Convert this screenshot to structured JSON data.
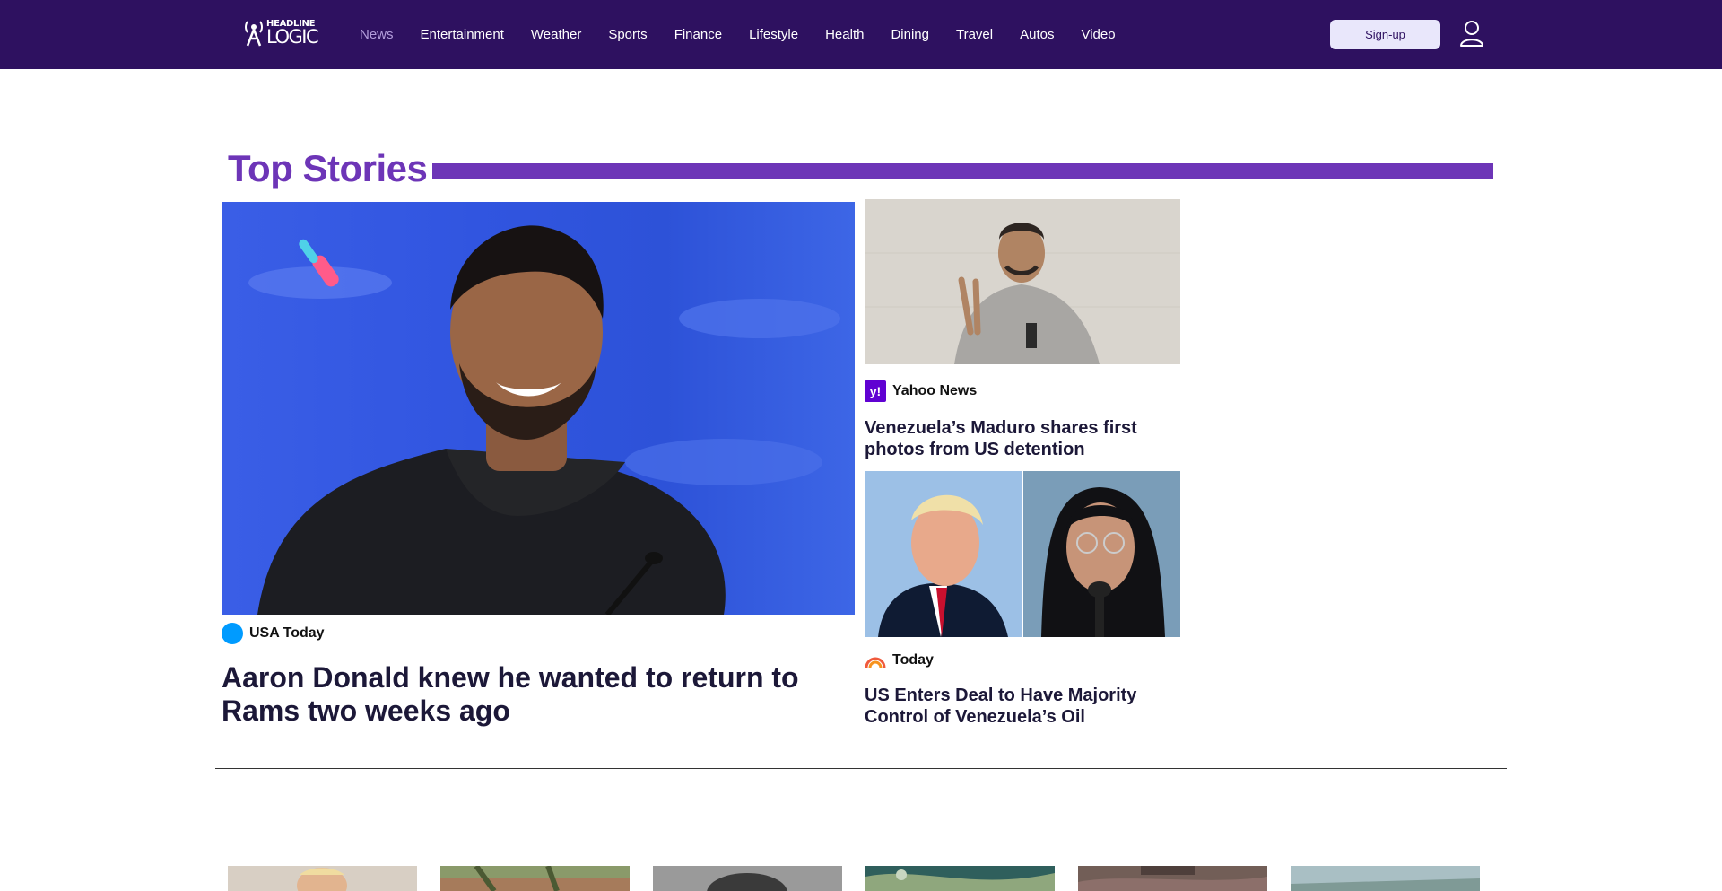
{
  "header": {
    "logo": {
      "line1": "HEADLINE",
      "line2": "LOGIC"
    },
    "nav": [
      {
        "label": "News",
        "active": true
      },
      {
        "label": "Entertainment"
      },
      {
        "label": "Weather"
      },
      {
        "label": "Sports"
      },
      {
        "label": "Finance"
      },
      {
        "label": "Lifestyle"
      },
      {
        "label": "Health"
      },
      {
        "label": "Dining"
      },
      {
        "label": "Travel"
      },
      {
        "label": "Autos"
      },
      {
        "label": "Video"
      }
    ],
    "signup_label": "Sign-up",
    "user_icon": "user-icon"
  },
  "top_stories": {
    "title": "Top Stories",
    "accent_color": "#6d35b7",
    "lead": {
      "source": "USA Today",
      "headline": "Aaron Donald knew he wanted to return to Rams two weeks ago"
    },
    "side": [
      {
        "source": "Yahoo News",
        "headline": "Venezuela’s Maduro shares first photos from US detention"
      },
      {
        "source": "Today",
        "headline": "US Enters Deal to Have Majority Control of Venezuela’s Oil"
      }
    ]
  },
  "colors": {
    "header_bg": "#2e1160",
    "nav_active": "#b39ddb",
    "headline": "#1c1838",
    "signup_bg": "#e9e7fb"
  }
}
